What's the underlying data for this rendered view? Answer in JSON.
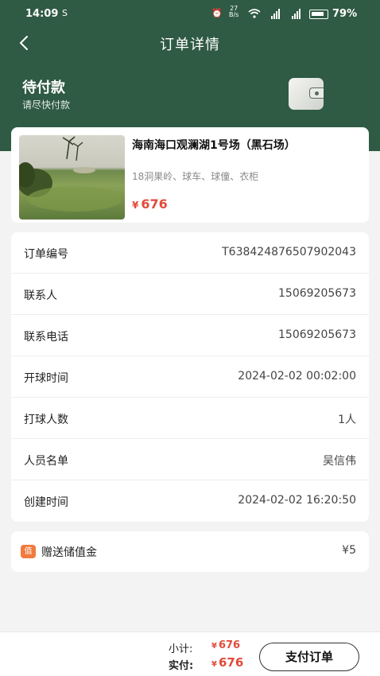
{
  "status_bar": {
    "time": "14:09",
    "speed_value": "27",
    "speed_unit": "B/s",
    "battery": "79%"
  },
  "nav": {
    "title": "订单详情"
  },
  "order_status": {
    "title": "待付款",
    "subtitle": "请尽快付款"
  },
  "product": {
    "name": "海南海口观澜湖1号场（黑石场）",
    "description": "18洞果岭、球车、球僮、衣柜",
    "currency": "¥",
    "price": "676"
  },
  "details": [
    {
      "label": "订单编号",
      "value": "T638424876507902043"
    },
    {
      "label": "联系人",
      "value": "15069205673"
    },
    {
      "label": "联系电话",
      "value": "15069205673"
    },
    {
      "label": "开球时间",
      "value": "2024-02-02 00:02:00"
    },
    {
      "label": "打球人数",
      "value": "1人"
    },
    {
      "label": "人员名单",
      "value": "吴信伟"
    },
    {
      "label": "创建时间",
      "value": "2024-02-02 16:20:50"
    }
  ],
  "bonus": {
    "badge": "值",
    "label": "赠送储值金",
    "value": "¥5"
  },
  "summary": {
    "subtotal_label": "小计:",
    "subtotal_currency": "¥",
    "subtotal_value": "676",
    "actual_label": "实付:",
    "actual_currency": "¥",
    "actual_value": "676",
    "pay_button": "支付订单"
  },
  "colors": {
    "header_green": "#2f5a43",
    "price_red": "#e14b3b",
    "badge_orange": "#f07b3f"
  }
}
